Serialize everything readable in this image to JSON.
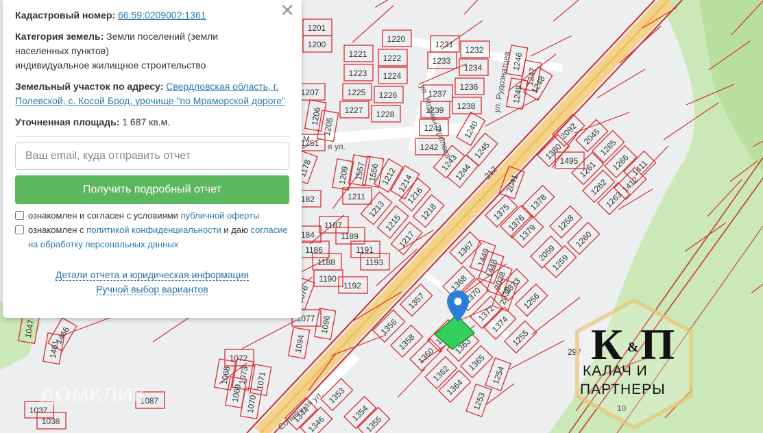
{
  "panel": {
    "close_symbol": "✕",
    "cadastral_label": "Кадастровый номер:",
    "cadastral_number": "66:59:0209002:1361",
    "category_label": "Категория земель:",
    "category_value_line1": "Земли поселений (земли",
    "category_value_line2": "населенных пунктов)",
    "permitted_use": "индивидуальное жилищное строительство",
    "address_label": "Земельный участок по адресу:",
    "address_value": "Свердловская область, г. Полевской, с. Косой Брод, урочище \"по Мраморской дороге\"",
    "area_label": "Уточненная площадь:",
    "area_value": "1 687 кв.м.",
    "email_placeholder": "Ваш email, куда отправить отчет",
    "submit_label": "Получить подробный отчет",
    "consent1_text": "ознакомлен и согласен с условиями",
    "consent1_link": "публичной оферты",
    "consent2_text_a": "ознакомлен с",
    "consent2_link_a": "политикой конфиденциальности",
    "consent2_text_b": "и даю",
    "consent2_link_b": "согласие на обработку персональных данных",
    "link_details": "Детали отчета и юридическая информация",
    "link_manual": "Ручной выбор вариантов"
  },
  "map": {
    "parcels": [
      "1201",
      "1200",
      "1220",
      "1221",
      "1222",
      "1223",
      "1224",
      "1225",
      "1226",
      "1227",
      "1228",
      "1207",
      "1206",
      "1205",
      "1251",
      "1231",
      "1232",
      "1233",
      "1234",
      "1236",
      "1237",
      "1238",
      "1239",
      "1241",
      "1240",
      "1242",
      "1243",
      "1244",
      "1245",
      "1246",
      "1247",
      "1248",
      "1249",
      "1209",
      "1557",
      "1556",
      "1212",
      "1214",
      "1211",
      "1213",
      "1216",
      "1215",
      "1217",
      "1218",
      "1182",
      "1184",
      "1187",
      "1186",
      "1189",
      "1188",
      "1191",
      "1190",
      "1192",
      "1193",
      "1380",
      "2092",
      "2045",
      "1495",
      "1261",
      "1265",
      "1266",
      "1411",
      "1262",
      "1412",
      "1263",
      "1375",
      "2041",
      "1378",
      "1376",
      "1258",
      "1379",
      "2059",
      "1260",
      "1259",
      "1367",
      "1449",
      "1448",
      "2038",
      "1368",
      "1370",
      "2039",
      "1373",
      "1372",
      "1256",
      "1374",
      "1255",
      "1357",
      "1356",
      "1358",
      "1360",
      "1361",
      "1363",
      "1362",
      "1365",
      "1364",
      "1254",
      "1253",
      "1353",
      "1354",
      "1344",
      "1346",
      "1355",
      "1076",
      "1077",
      "1096",
      "1094",
      "1072",
      "1073",
      "1068",
      "1071",
      "1069",
      "1070",
      "1087",
      "1037",
      "1038",
      "1047",
      "1466",
      "1461",
      "1178"
    ],
    "street_1": "ул. Козьмы Фролова",
    "street_2": "ул. Рудознатцев",
    "street_3": "Солнечная ул.",
    "street_4": "М",
    "street_5": "я ул.",
    "road_number": "212",
    "label_297": "297",
    "label_10": "10",
    "watermark": "ДОМКЛИК",
    "logo_k": "К",
    "logo_amp": "&",
    "logo_p": "П",
    "logo_line1": "КАЛАЧ И",
    "logo_line2": "ПАРТНЕРЫ",
    "selected_color": "#33d15c",
    "parcel_line_color": "#d92d2d",
    "marker_color": "#2b7fd6"
  }
}
